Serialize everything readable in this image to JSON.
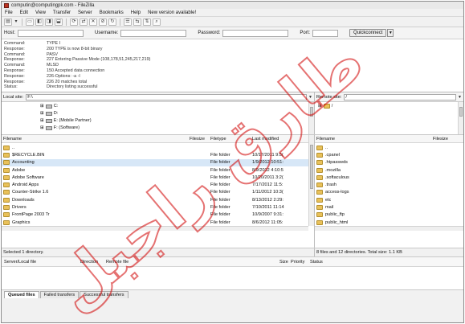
{
  "window": {
    "title": "computin@computingpk.com - FileZilla"
  },
  "menu": [
    "File",
    "Edit",
    "View",
    "Transfer",
    "Server",
    "Bookmarks",
    "Help",
    "New version available!"
  ],
  "quickconnect": {
    "host_label": "Host:",
    "username_label": "Username:",
    "password_label": "Password:",
    "port_label": "Port:",
    "button_label": "Quickconnect"
  },
  "log": [
    {
      "type": "Command:",
      "msg": "TYPE I"
    },
    {
      "type": "Response:",
      "msg": "200 TYPE is now 8-bit binary"
    },
    {
      "type": "Command:",
      "msg": "PASV"
    },
    {
      "type": "Response:",
      "msg": "227 Entering Passive Mode (108,178,51,245,217,219)"
    },
    {
      "type": "Command:",
      "msg": "MLSD"
    },
    {
      "type": "Response:",
      "msg": "150 Accepted data connection"
    },
    {
      "type": "Response:",
      "msg": "226-Options: -a -l"
    },
    {
      "type": "Response:",
      "msg": "226 20 matches total"
    },
    {
      "type": "Status:",
      "msg": "Directory listing successful"
    }
  ],
  "local_site": {
    "label": "Local site:",
    "value": "F:\\"
  },
  "remote_site": {
    "label": "Remote site:",
    "value": "/"
  },
  "local_tree": [
    "C:",
    "D:",
    "E: (Mobile Partner)",
    "F: (Software)"
  ],
  "remote_tree": [
    "/"
  ],
  "local_columns": [
    "Filename",
    "Filesize",
    "Filetype",
    "Last modified"
  ],
  "remote_columns": [
    "Filename",
    "Filesize"
  ],
  "local_files": [
    {
      "name": "..",
      "type": "",
      "modified": ""
    },
    {
      "name": "$RECYCLE.BIN",
      "type": "File folder",
      "modified": "10/17/2011 9:5("
    },
    {
      "name": "Accounting",
      "type": "File folder",
      "modified": "1/9/2012 10:51:"
    },
    {
      "name": "Adobe",
      "type": "File folder",
      "modified": "8/9/2012 4:10:5"
    },
    {
      "name": "Adobe Software",
      "type": "File folder",
      "modified": "10/20/2011 3:2("
    },
    {
      "name": "Android Apps",
      "type": "File folder",
      "modified": "7/17/2012 11:5:"
    },
    {
      "name": "Counter-Strike 1.6",
      "type": "File folder",
      "modified": "1/11/2012 10:3("
    },
    {
      "name": "Downloads",
      "type": "File folder",
      "modified": "8/13/2012 2:29:"
    },
    {
      "name": "Drivers",
      "type": "File folder",
      "modified": "7/10/2011 11:14"
    },
    {
      "name": "FrontPage 2003 Tr",
      "type": "File folder",
      "modified": "10/9/2007 9:31:"
    },
    {
      "name": "Graphics",
      "type": "File folder",
      "modified": "8/6/2012 11:05:"
    }
  ],
  "remote_files": [
    "..",
    ".cpanel",
    ".htpasswds",
    ".mozilla",
    ".softaculous",
    ".trash",
    "access-logs",
    "etc",
    "mail",
    "public_ftp",
    "public_html"
  ],
  "local_status": "Selected 1 directory.",
  "remote_status": "8 files and 12 directories. Total size: 1.1 KB",
  "queue_columns": [
    "Server/Local file",
    "Direction",
    "Remote file",
    "Size",
    "Priority",
    "Status"
  ],
  "queue_tabs": [
    "Queued files",
    "Failed transfers",
    "Successful transfers"
  ],
  "watermark": {
    "text": "طارق راجبل"
  },
  "colors": {
    "selected_row": "#d7e7f7",
    "folder": "#e9c15a",
    "watermark": "#d10000"
  }
}
